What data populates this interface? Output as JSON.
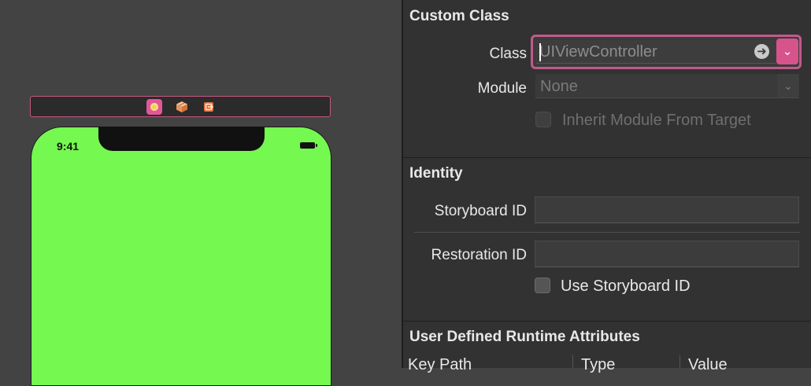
{
  "canvas": {
    "status_time": "9:41",
    "dock_icons": [
      "view-controller-icon",
      "first-responder-cube-icon",
      "exit-icon"
    ],
    "view_background_color": "#75f84f"
  },
  "inspector": {
    "custom_class": {
      "title": "Custom Class",
      "class_label": "Class",
      "class_placeholder": "UIViewController",
      "module_label": "Module",
      "module_value": "None",
      "inherit_label": "Inherit Module From Target",
      "inherit_checked": false
    },
    "identity": {
      "title": "Identity",
      "storyboard_id_label": "Storyboard ID",
      "storyboard_id_value": "",
      "restoration_id_label": "Restoration ID",
      "restoration_id_value": "",
      "use_storyboard_id_label": "Use Storyboard ID",
      "use_storyboard_id_checked": false
    },
    "runtime_attributes": {
      "title": "User Defined Runtime Attributes",
      "columns": [
        "Key Path",
        "Type",
        "Value"
      ]
    }
  },
  "colors": {
    "accent": "#d6538c",
    "selection_border": "#c05a8b"
  }
}
